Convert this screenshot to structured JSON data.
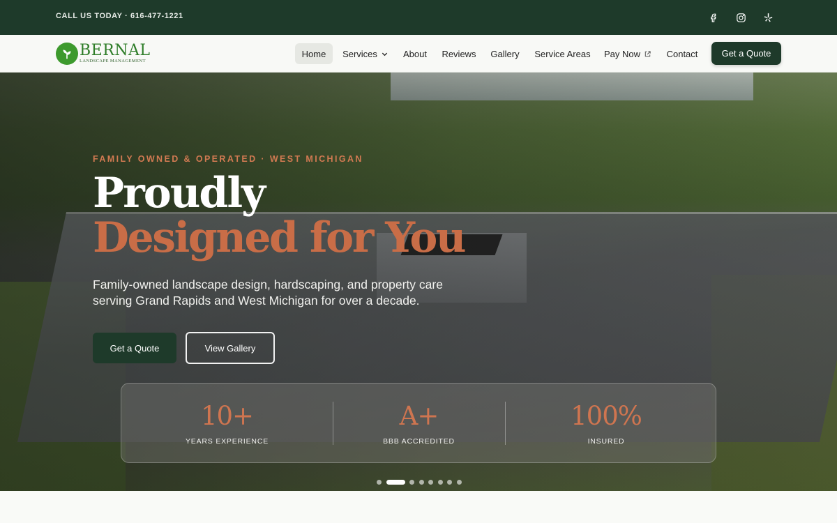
{
  "topbar": {
    "phone": "CALL US TODAY · 616-477-1221",
    "social": [
      {
        "icon": "facebook-icon"
      },
      {
        "icon": "instagram-icon"
      },
      {
        "icon": "yelp-icon"
      }
    ]
  },
  "nav": {
    "logo_word": "BERNAL",
    "logo_sub": "LANDSCAPE MANAGEMENT",
    "items": [
      {
        "label": "Home",
        "active": true
      },
      {
        "label": "Services"
      },
      {
        "label": "About"
      },
      {
        "label": "Reviews"
      },
      {
        "label": "Gallery"
      },
      {
        "label": "Service Areas"
      },
      {
        "label": "Pay Now"
      },
      {
        "label": "Contact"
      }
    ],
    "cta": "Get a Quote"
  },
  "hero": {
    "eyebrow": "FAMILY OWNED & OPERATED · WEST MICHIGAN",
    "title_line1": "Proudly",
    "title_line2": "Designed for You",
    "description": "Family-owned landscape design, hardscaping, and property care serving Grand Rapids and West Michigan for over a decade.",
    "primary_button": "Get a Quote",
    "secondary_button": "View Gallery",
    "stats": [
      {
        "value": "10+",
        "label": "YEARS EXPERIENCE"
      },
      {
        "value": "A+",
        "label": "BBB ACCREDITED"
      },
      {
        "value": "100%",
        "label": "INSURED"
      }
    ],
    "carousel": {
      "slides": 8,
      "active_index": 1
    }
  },
  "colors": {
    "brand_green": "#1e3a2a",
    "accent_terracotta": "#c96d47",
    "logo_green": "#2e7d28"
  }
}
